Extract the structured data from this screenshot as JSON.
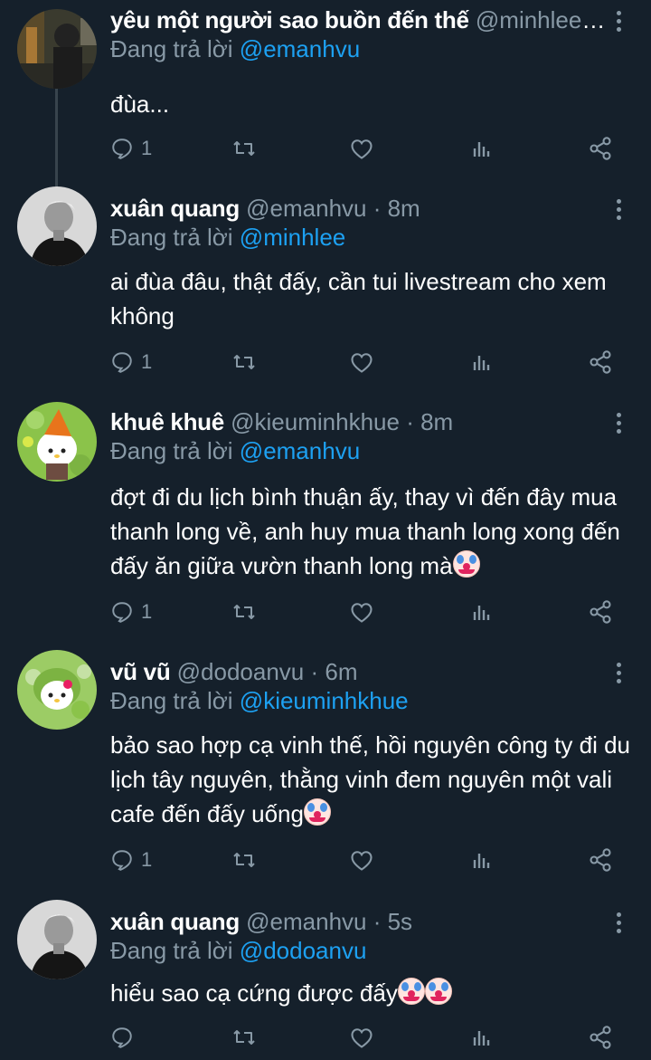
{
  "tweets": [
    {
      "name": "yêu một người sao buồn đến thế",
      "handle": "@minhlee ·...",
      "replying_prefix": "Đang trả lời",
      "replying_to": "@emanhvu",
      "text": "đùa...",
      "reply_count": "1"
    },
    {
      "name": "xuân quang",
      "handle": "@emanhvu · 8m",
      "replying_prefix": "Đang trả lời",
      "replying_to": "@minhlee",
      "text": "ai đùa đâu, thật đấy, cần tui livestream cho xem không",
      "reply_count": "1"
    },
    {
      "name": "khuê khuê",
      "handle": "@kieuminhkhue · 8m",
      "replying_prefix": "Đang trả lời",
      "replying_to": "@emanhvu",
      "text": "đợt đi du lịch bình thuận ấy, thay vì đến đây mua thanh long về, anh huy mua thanh long xong đến đấy ăn giữa vườn thanh long mà",
      "emoji_count": 1,
      "reply_count": "1"
    },
    {
      "name": "vũ vũ",
      "handle": "@dodoanvu · 6m",
      "replying_prefix": "Đang trả lời",
      "replying_to": "@kieuminhkhue",
      "text": "bảo sao hợp cạ vinh thế, hồi nguyên công ty đi du lịch tây nguyên, thằng vinh đem nguyên một vali cafe đến đấy uống",
      "emoji_count": 1,
      "reply_count": "1"
    },
    {
      "name": "xuân quang",
      "handle": "@emanhvu · 5s",
      "replying_prefix": "Đang trả lời",
      "replying_to": "@dodoanvu",
      "text": "hiểu sao cạ cứng được đấy",
      "emoji_count": 2,
      "reply_count": ""
    }
  ],
  "icons": {
    "reply": "reply-icon",
    "retweet": "retweet-icon",
    "like": "heart-icon",
    "analytics": "analytics-icon",
    "share": "share-icon",
    "more": "more-vertical-icon",
    "emoji": "clown-face-emoji"
  },
  "colors": {
    "background": "#15202b",
    "text": "#ffffff",
    "muted": "#8899a6",
    "link": "#1da1f2",
    "thread_line": "#38444d"
  }
}
